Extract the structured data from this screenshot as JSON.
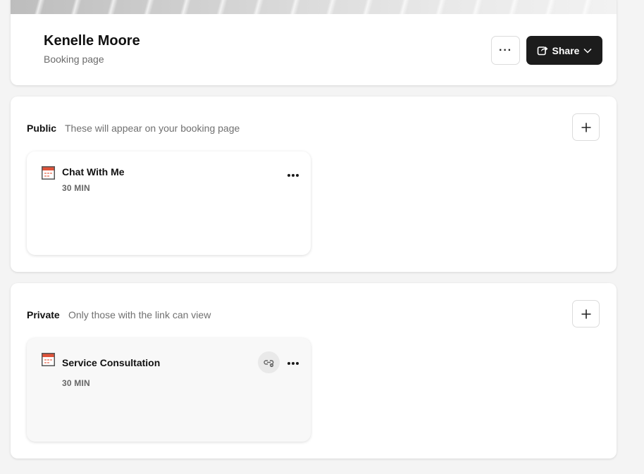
{
  "profile": {
    "name": "Kenelle Moore",
    "subtitle": "Booking page"
  },
  "header": {
    "more_label": "···",
    "share_label": "Share"
  },
  "sections": {
    "public": {
      "title": "Public",
      "description": "These will appear on your booking page",
      "events": [
        {
          "title": "Chat With Me",
          "duration": "30 MIN"
        }
      ]
    },
    "private": {
      "title": "Private",
      "description": "Only those with the link can view",
      "events": [
        {
          "title": "Service Consultation",
          "duration": "30 MIN"
        }
      ]
    }
  },
  "icons": {
    "share": "share-icon",
    "chevron": "chevron-down-icon",
    "add": "plus-icon",
    "calendar": "calendar-icon",
    "private_link": "link-icon",
    "more": "more-horizontal-icon"
  },
  "colors": {
    "primary_button": "#1c1c1c",
    "calendar_accent": "#e0533a",
    "background": "#f4f4f4"
  }
}
